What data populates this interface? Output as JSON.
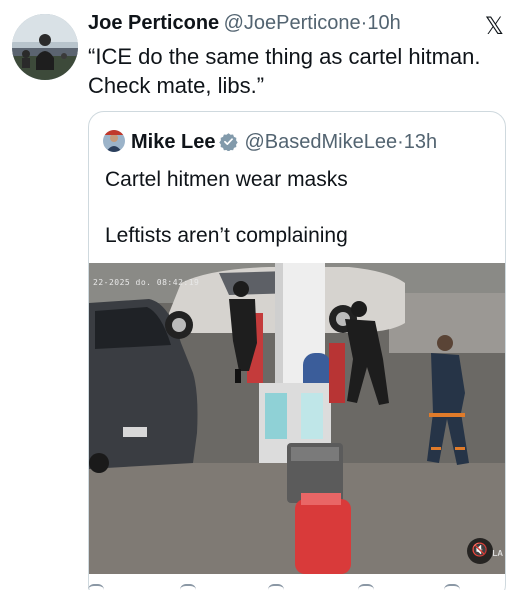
{
  "author": {
    "display_name": "Joe Perticone",
    "handle": "@JoePerticone",
    "separator": "·",
    "time": "10h",
    "avatar_icon": "avatar-photo"
  },
  "x_logo": "𝕏",
  "tweet_text": "“ICE do the same thing as cartel hitman. Check mate, libs.”",
  "quote": {
    "display_name": "Mike Lee",
    "verified_icon": "verified-badge-icon",
    "handle": "@BasedMikeLee",
    "separator": "·",
    "time": "13h",
    "text_line1": "Cartel hitmen wear masks",
    "text_line2": "Leftists aren’t complaining",
    "media": {
      "timestamp_overlay": "22-2025 do. 08:42:19",
      "mute_icon": "muted-speaker-icon",
      "mute_glyph": "🔇",
      "corner_logo": "LA"
    }
  },
  "colors": {
    "text": "#0f1419",
    "secondary": "#536471",
    "border": "#cfd9de",
    "verified": "#829aab"
  }
}
